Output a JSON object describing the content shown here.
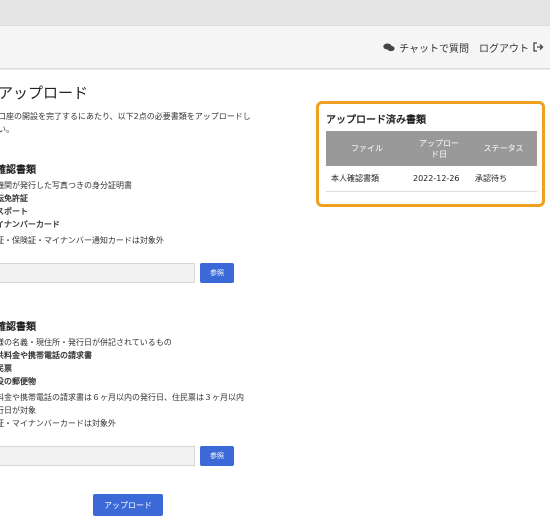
{
  "header": {
    "chat_label": "チャットで質問",
    "logout_label": "ログアウト"
  },
  "page": {
    "title": "アップロード",
    "intro_line1": "口座の開設を完了するにあたり、以下2点の必要書類をアップロードし",
    "intro_line2": "い。"
  },
  "section1": {
    "title": "確認書類",
    "desc": "機関が発行した写真つきの身分証明書",
    "items": [
      "転免許証",
      "スポート",
      "イナンバーカード"
    ],
    "note": "証・保険証・マイナンバー通知カードは対象外"
  },
  "section2": {
    "title": "確認書類",
    "desc": "様の名義・現住所・発行日が併記されているもの",
    "items": [
      "共料金や携帯電話の請求書",
      "民票",
      "役の郵便物"
    ],
    "note_line1": "料金や携帯電話の請求書は６ヶ月以内の発行日、住民票は３ヶ月以内",
    "note_line2": "行日が対象",
    "note_line3": "証・マイナンバーカードは対象外"
  },
  "buttons": {
    "ref_label": "参照",
    "upload_label": "アップロード"
  },
  "uploaded": {
    "title": "アップロード済み書類",
    "columns": [
      "ファイル",
      "アップロー\nド日",
      "ステータス"
    ],
    "col_file": "ファイル",
    "col_date_1": "アップロー",
    "col_date_2": "ド日",
    "col_status": "ステータス",
    "rows": [
      {
        "file": "本人確認書類",
        "date": "2022-12-26",
        "status": "承認待ち"
      }
    ]
  },
  "colors": {
    "accent": "#3b6ad8",
    "highlight": "#f0a020",
    "table_header": "#999999"
  }
}
